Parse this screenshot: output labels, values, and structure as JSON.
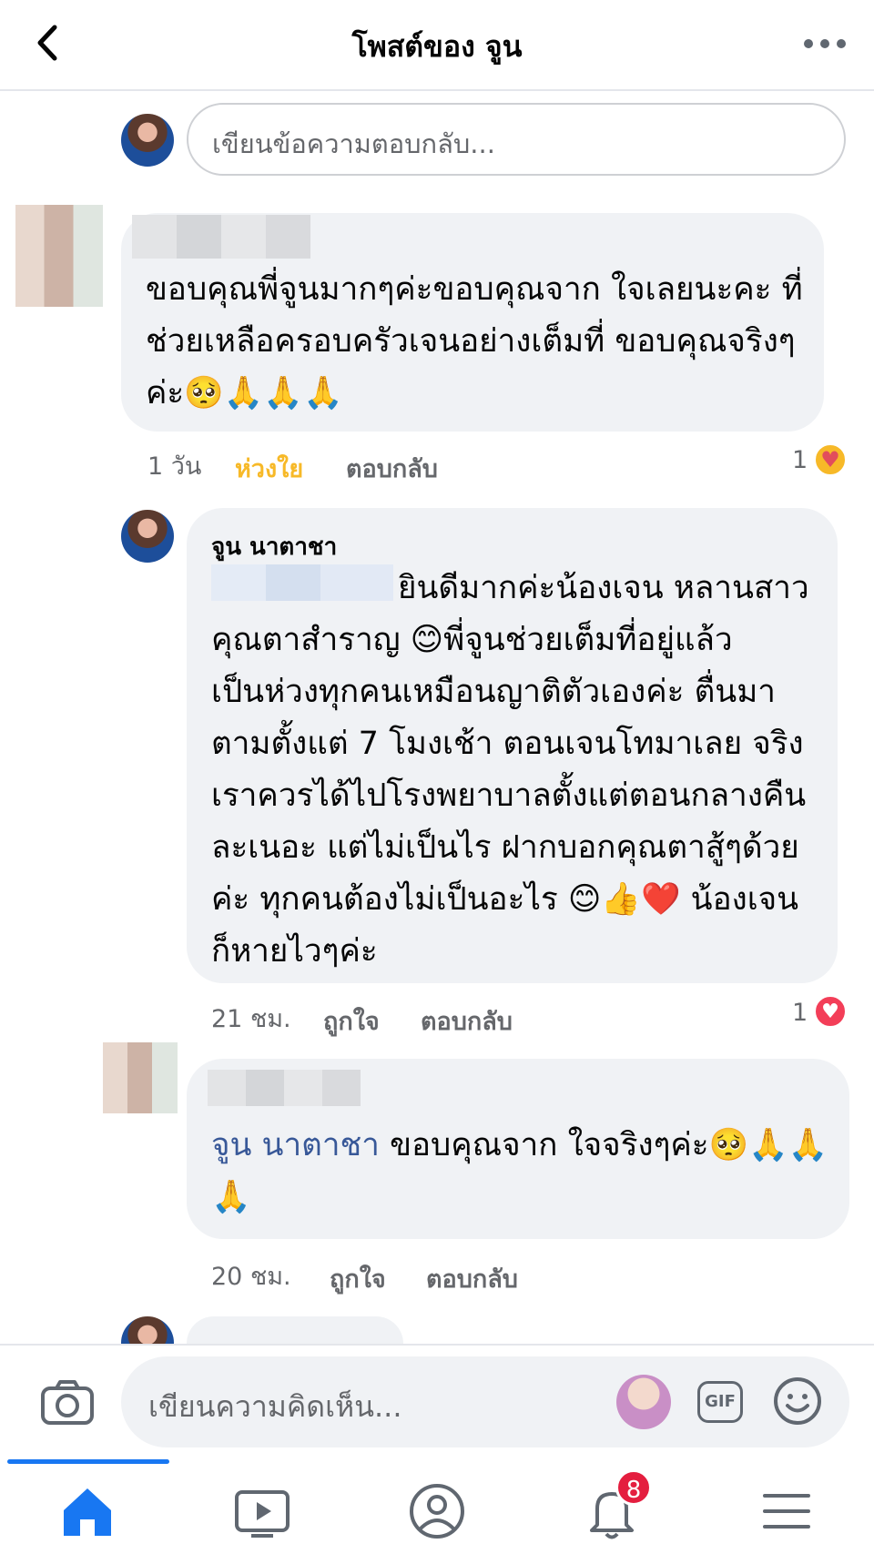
{
  "header": {
    "title": "โพสต์ของ จูน"
  },
  "reply_box": {
    "placeholder": "เขียนข้อความตอบกลับ..."
  },
  "comments": [
    {
      "text": "ขอบคุณพี่จูนมากๆค่ะขอบคุณจาก ใจเลยนะคะ ที่ช่วยเหลือครอบครัวเจนอย่างเต็มที่ ขอบคุณจริงๆค่ะ🥺🙏🙏🙏",
      "lines": [
        "ขอบคุณพี่จูนมากๆค่ะขอบคุณจาก ใจเลยนะคะ ที่",
        "ช่วยเหลือครอบครัวเจนอย่างเต็มที่ ขอบคุณจริงๆ",
        "ค่ะ🥺🙏🙏🙏"
      ],
      "time": "1 วัน",
      "like": "ห่วงใย",
      "reply": "ตอบกลับ",
      "reaction_count": "1"
    },
    {
      "name": "จูน นาตาชา",
      "lines": [
        "ยินดีมากค่ะน้องเจน  หลานสาว",
        "คุณตาสำราญ 😊พี่จูนช่วยเต็มที่อยู่แล้ว",
        "เป็นห่วงทุกคนเหมือนญาติตัวเองค่ะ ตื่นมา",
        "ตามตั้งแต่ 7 โมงเช้า ตอนเจนโทมาเลย จริง",
        "เราควรได้ไปโรงพยาบาลตั้งแต่ตอนกลางคืน",
        "ละเนอะ แต่ไม่เป็นไร ฝากบอกคุณตาสู้ๆด้วย",
        "ค่ะ ทุกคนต้องไม่เป็นอะไร 😊👍❤️ น้องเจน",
        "ก็หายไวๆค่ะ"
      ],
      "time": "21 ชม.",
      "like": "ถูกใจ",
      "reply": "ตอบกลับ",
      "reaction_count": "1"
    },
    {
      "mention": "จูน นาตาชา",
      "line1": " ขอบคุณจาก ใจจริงๆค่ะ🥺🙏🙏",
      "line2": "🙏",
      "time": "20 ชม.",
      "like": "ถูกใจ",
      "reply": "ตอบกลับ"
    }
  ],
  "composer": {
    "placeholder": "เขียนความคิดเห็น...",
    "gif_label": "GIF"
  },
  "nav": {
    "notification_badge": "8"
  },
  "colors": {
    "accent": "#1877f2",
    "care": "#f7b928",
    "heart": "#f33e58",
    "bubble": "#f0f2f5"
  }
}
